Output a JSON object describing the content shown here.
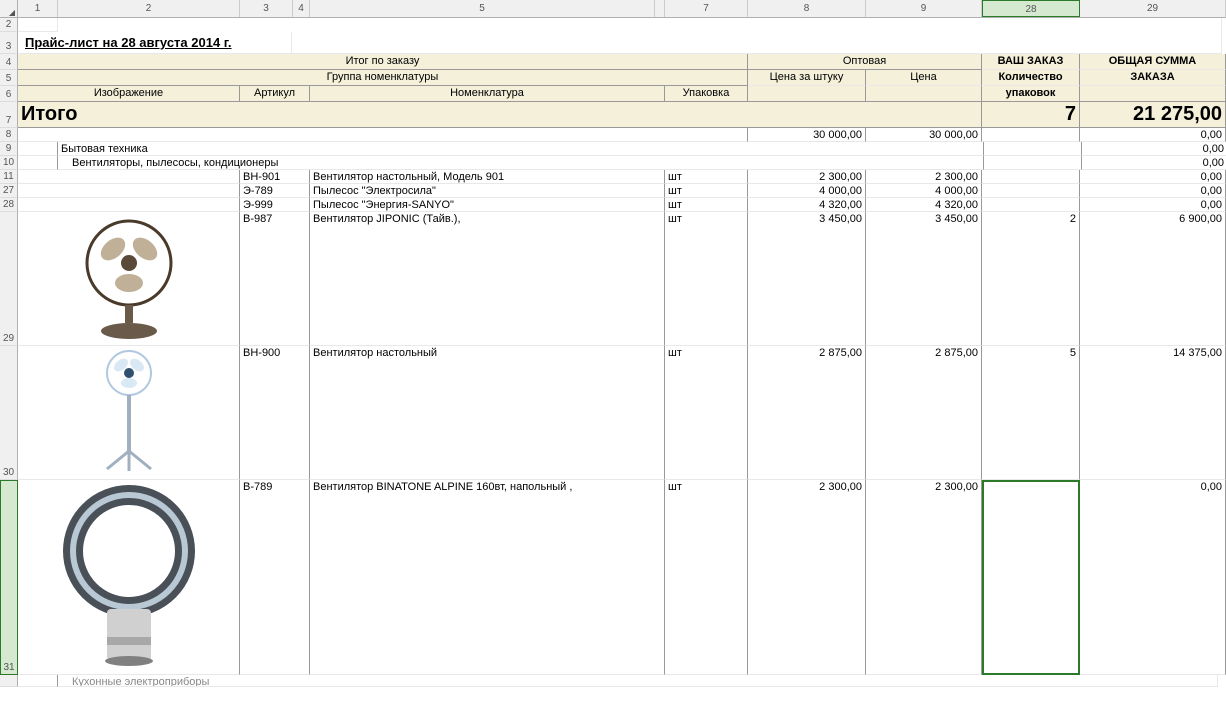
{
  "colHeaders": [
    "1",
    "2",
    "3",
    "4",
    "5",
    "7",
    "8",
    "9",
    "28",
    "29"
  ],
  "activeCol": "28",
  "rowNums": [
    "2",
    "3",
    "4",
    "5",
    "6",
    "7",
    "8",
    "9",
    "10",
    "11",
    "27",
    "28",
    "29",
    "30",
    "31"
  ],
  "activeRow": "31",
  "title": "Прайс-лист на 28 августа 2014 г.",
  "header": {
    "orderSummary": "Итог по заказу",
    "wholesale": "Оптовая",
    "yourOrder": "ВАШ ЗАКАЗ",
    "totalSum": "ОБЩАЯ СУММА",
    "nomenclatureGroup": "Группа номенклатуры",
    "pricePerUnit": "Цена за штуку",
    "price": "Цена",
    "packQty": "Количество",
    "order": "ЗАКАЗА",
    "image": "Изображение",
    "sku": "Артикул",
    "nomenclature": "Номенклатура",
    "packaging": "Упаковка",
    "packs": "упаковок"
  },
  "totals": {
    "label": "Итого",
    "qty": "7",
    "sum": "21 275,00"
  },
  "cat1": {
    "name": "Бытовая техника",
    "price1": "30 000,00",
    "price2": "30 000,00",
    "sum": "0,00",
    "blankSum": "0,00"
  },
  "cat2": {
    "name": "Вентиляторы, пылесосы, кондиционеры",
    "sum": "0,00"
  },
  "items": [
    {
      "sku": "ВН-901",
      "name": "Вентилятор настольный, Модель 901",
      "unit": "шт",
      "p1": "2 300,00",
      "p2": "2 300,00",
      "qty": "",
      "sum": "0,00"
    },
    {
      "sku": "Э-789",
      "name": "Пылесос \"Электросила\"",
      "unit": "шт",
      "p1": "4 000,00",
      "p2": "4 000,00",
      "qty": "",
      "sum": "0,00"
    },
    {
      "sku": "Э-999",
      "name": "Пылесос \"Энергия-SANYO\"",
      "unit": "шт",
      "p1": "4 320,00",
      "p2": "4 320,00",
      "qty": "",
      "sum": "0,00"
    },
    {
      "sku": "В-987",
      "name": "Вентилятор JIPONIC (Тайв.),",
      "unit": "шт",
      "p1": "3 450,00",
      "p2": "3 450,00",
      "qty": "2",
      "sum": "6 900,00"
    },
    {
      "sku": "ВН-900",
      "name": "Вентилятор настольный",
      "unit": "шт",
      "p1": "2 875,00",
      "p2": "2 875,00",
      "qty": "5",
      "sum": "14 375,00"
    },
    {
      "sku": "В-789",
      "name": "Вентилятор BINATONE ALPINE 160вт, напольный ,",
      "unit": "шт",
      "p1": "2 300,00",
      "p2": "2 300,00",
      "qty": "",
      "sum": "0,00"
    }
  ],
  "footerCat": "Кухонные электроприборы"
}
